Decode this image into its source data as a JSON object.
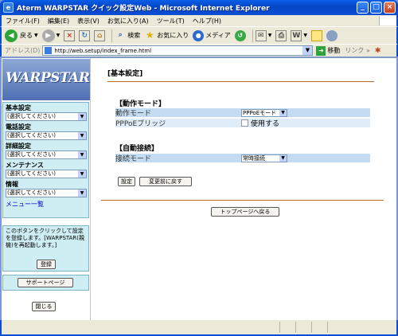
{
  "window": {
    "title": "Aterm WARPSTAR クイック設定Web - Microsoft Internet Explorer"
  },
  "menubar": {
    "items": [
      "ファイル(F)",
      "編集(E)",
      "表示(V)",
      "お気に入り(A)",
      "ツール(T)",
      "ヘルプ(H)"
    ]
  },
  "toolbar": {
    "back_label": "戻る",
    "search_label": "検索",
    "favorites_label": "お気に入り",
    "media_label": "メディア"
  },
  "addressbar": {
    "label": "アドレス(D)",
    "url": "http://web.setup/index_frame.html",
    "go_label": "移動",
    "links_label": "リンク »"
  },
  "sidebar": {
    "logo_text": "WARPSTAR",
    "groups": [
      {
        "title": "基本設定",
        "selected": "(選択してください)"
      },
      {
        "title": "電話設定",
        "selected": "(選択してください)"
      },
      {
        "title": "詳細設定",
        "selected": "(選択してください)"
      },
      {
        "title": "メンテナンス",
        "selected": "(選択してください)"
      },
      {
        "title": "情報",
        "selected": "(選択してください)"
      }
    ],
    "menu_list_link": "メニュー一覧",
    "info_text": "このボタンをクリックして設定を登録します。[WARPSTAR(親機)を再起動します。]",
    "register_button": "登録",
    "support_button": "サポートページ",
    "close_button": "閉じる"
  },
  "main": {
    "heading": "[基本設定]",
    "operation_mode": {
      "section_title": "【動作モード】",
      "mode_label": "動作モード",
      "mode_value": "PPPoEモード",
      "bridge_label": "PPPoEブリッジ",
      "bridge_checkbox_label": "使用する",
      "bridge_checked": false
    },
    "auto_connect": {
      "section_title": "【自動接続】",
      "mode_label": "接続モード",
      "mode_value": "常時接続"
    },
    "apply_button": "設定",
    "revert_button": "変更前に戻す",
    "top_page_button": "トップページへ戻る"
  }
}
